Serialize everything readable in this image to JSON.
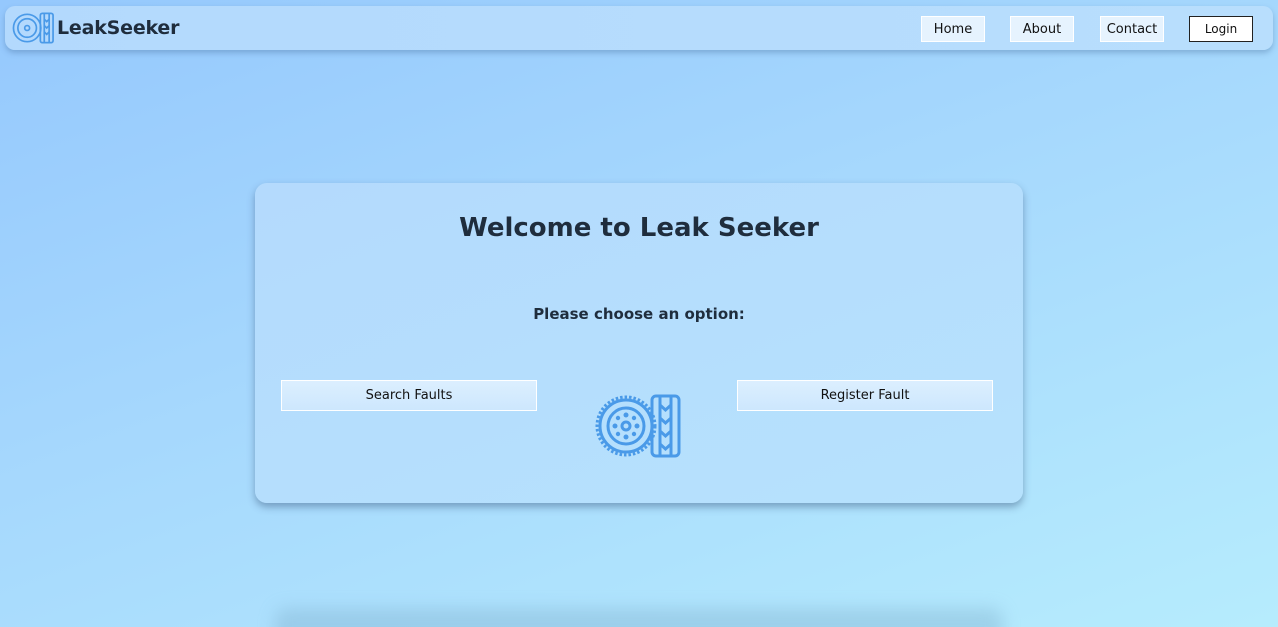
{
  "navbar": {
    "brand_name": "LeakSeeker",
    "brand_icon": "tire-wheel-icon",
    "links": {
      "home": "Home",
      "about": "About",
      "contact": "Contact"
    },
    "login_label": "Login"
  },
  "main": {
    "title": "Welcome to Leak Seeker",
    "subtitle": "Please choose an option:",
    "search_faults_label": "Search Faults",
    "register_fault_label": "Register Fault",
    "center_icon": "tire-wheel-icon"
  },
  "colors": {
    "accent_icon": "#4a9ae8",
    "text": "#1f2d3d"
  }
}
